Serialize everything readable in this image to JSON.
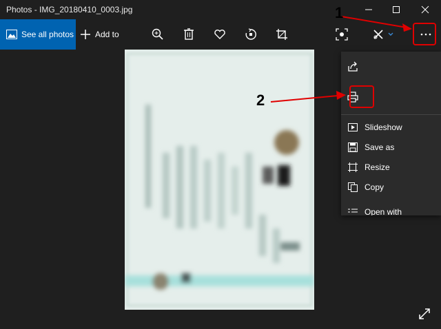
{
  "window": {
    "title": "Photos - IMG_20180410_0003.jpg"
  },
  "toolbar": {
    "see_all_label": "See all photos",
    "add_to_label": "Add to",
    "icons": [
      "zoom-in-icon",
      "delete-icon",
      "favorite-icon",
      "rotate-icon",
      "crop-icon",
      "enhance-icon",
      "edit-draw-icon",
      "more-icon"
    ]
  },
  "menu": {
    "items": [
      {
        "label": "Slideshow",
        "icon": "slideshow-icon"
      },
      {
        "label": "Save as",
        "icon": "save-icon"
      },
      {
        "label": "Resize",
        "icon": "resize-icon"
      },
      {
        "label": "Copy",
        "icon": "copy-icon"
      },
      {
        "label": "Open with",
        "icon": "open-with-icon"
      }
    ],
    "top_icons": [
      "share-icon",
      "print-icon"
    ]
  },
  "annotations": {
    "step1": "1",
    "step2": "2"
  },
  "colors": {
    "accent": "#0063b1",
    "background": "#1f1f1f",
    "annotation": "#e00000"
  }
}
